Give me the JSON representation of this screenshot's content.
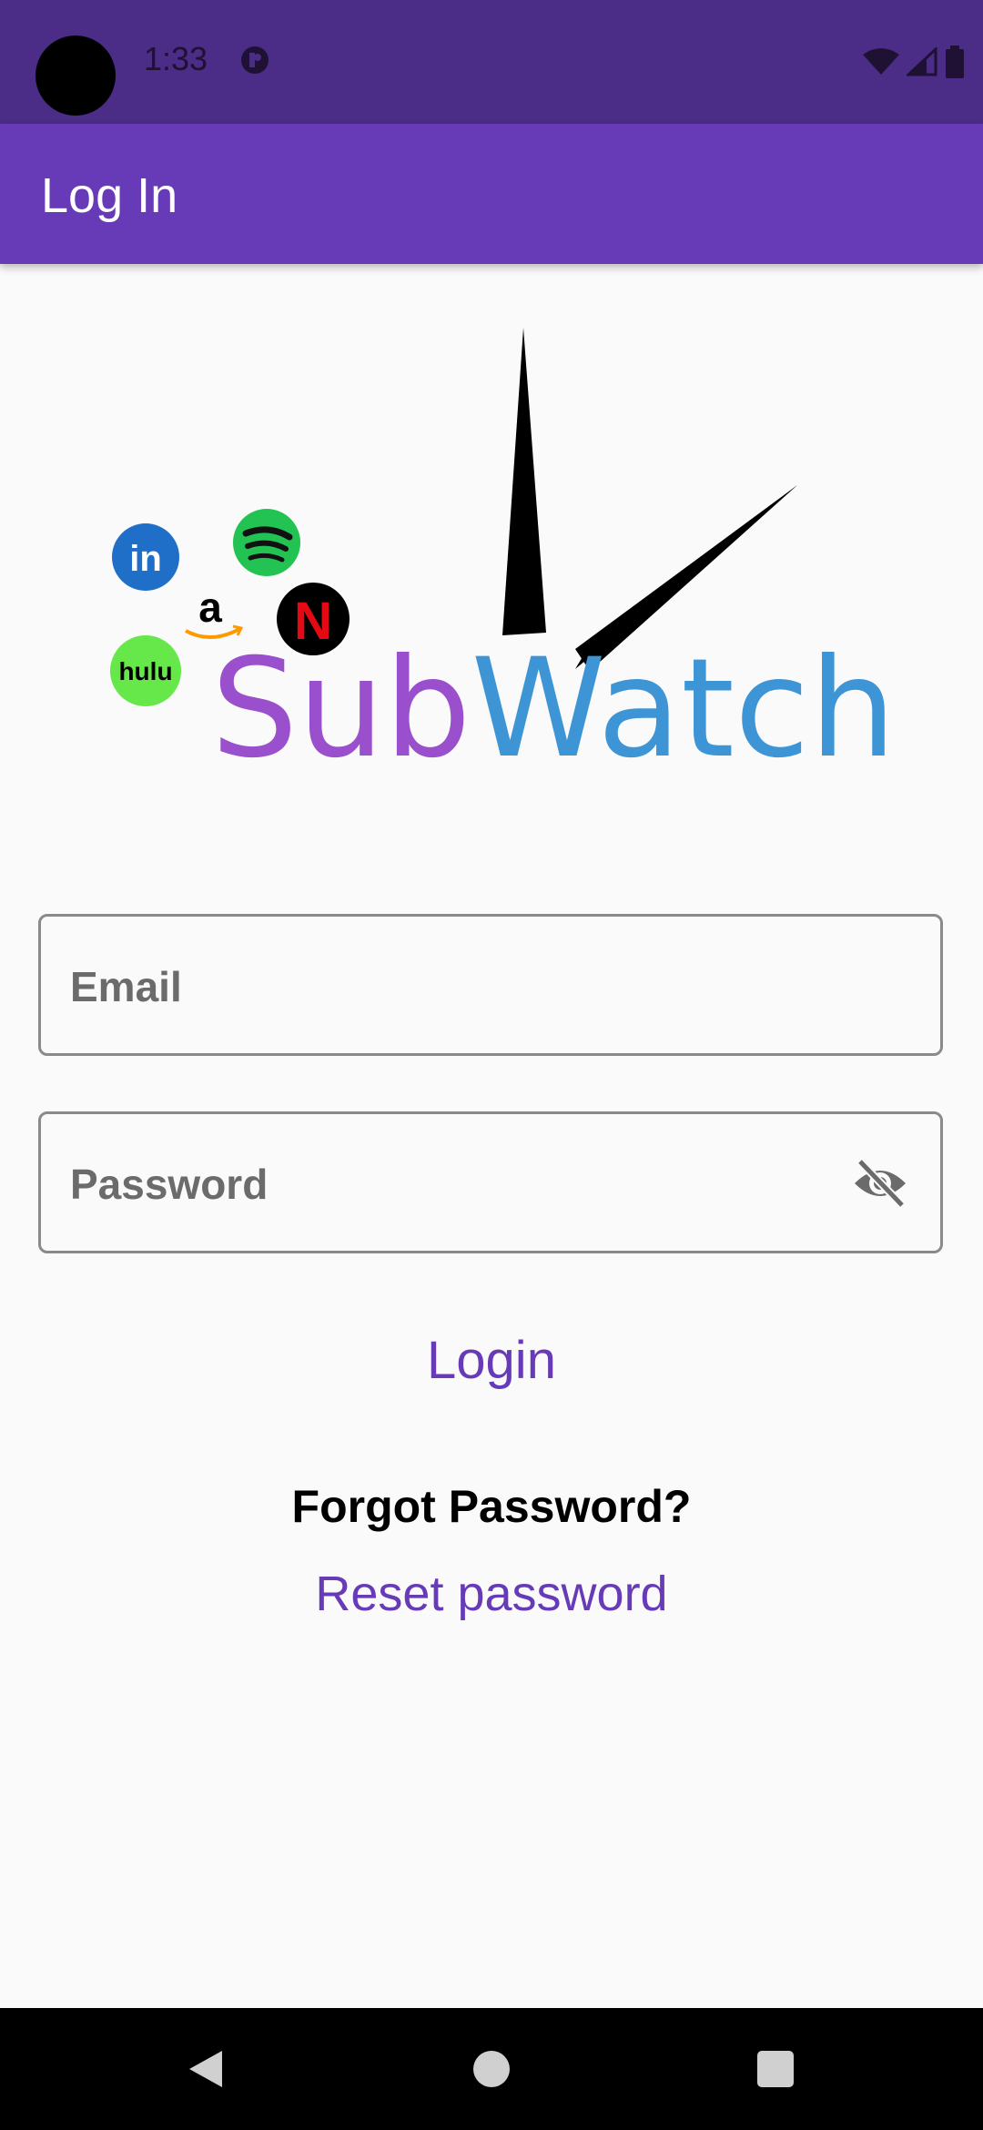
{
  "status_bar": {
    "time": "1:33"
  },
  "app_bar": {
    "title": "Log In"
  },
  "logo": {
    "brand_part1": "Sub",
    "brand_part2": "Watch",
    "brand_color1": "#9a4fcc",
    "brand_color2": "#3d95d6",
    "badges": [
      "linkedin-logo",
      "spotify-logo",
      "amazon-logo",
      "netflix-logo",
      "hulu-logo"
    ],
    "hulu_text": "hulu",
    "linkedin_text": "in",
    "amazon_text": "a",
    "netflix_text": "N"
  },
  "form": {
    "email_label": "Email",
    "password_label": "Password",
    "login_label": "Login",
    "forgot_heading": "Forgot Password?",
    "reset_link": "Reset password"
  },
  "colors": {
    "accent": "#673ab7",
    "status_bar": "#4b2c86"
  }
}
